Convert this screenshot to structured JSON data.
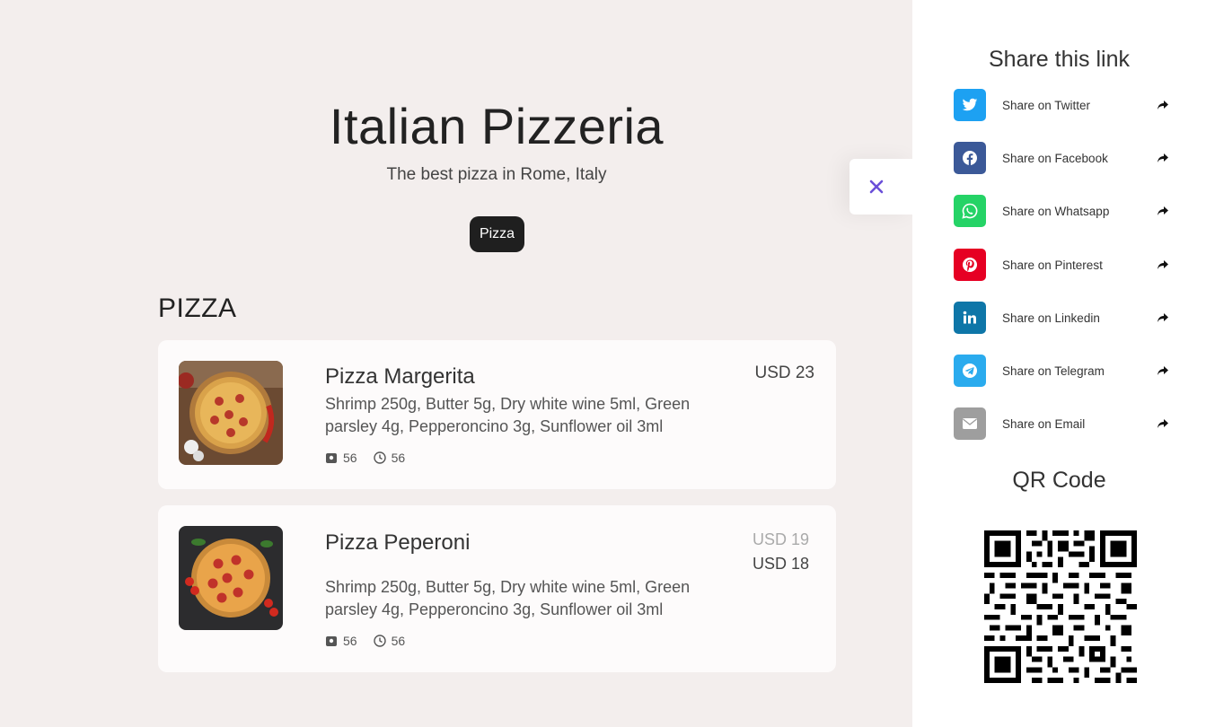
{
  "hero": {
    "title": "Italian Pizzeria",
    "subtitle": "The best pizza in Rome, Italy",
    "category_chip": "Pizza"
  },
  "section": {
    "title": "PIZZA"
  },
  "items": [
    {
      "name": "Pizza Margerita",
      "description": "Shrimp 250g, Butter 5g, Dry white wine 5ml, Green parsley 4g, Pepperoncino 3g, Sunflower oil 3ml",
      "weight": "56",
      "time": "56",
      "price": "USD 23"
    },
    {
      "name": "Pizza Peperoni",
      "description": "Shrimp 250g, Butter 5g, Dry white wine 5ml, Green parsley 4g, Pepperoncino 3g, Sunflower oil 3ml",
      "weight": "56",
      "time": "56",
      "price_old": "USD 19",
      "price_new": "USD 18"
    }
  ],
  "share_panel": {
    "title": "Share this link",
    "items": [
      {
        "label": "Share on Twitter",
        "icon": "twitter-icon",
        "color": "#1da1f2"
      },
      {
        "label": "Share on Facebook",
        "icon": "facebook-icon",
        "color": "#3b5998"
      },
      {
        "label": "Share on Whatsapp",
        "icon": "whatsapp-icon",
        "color": "#25d366"
      },
      {
        "label": "Share on Pinterest",
        "icon": "pinterest-icon",
        "color": "#e60023"
      },
      {
        "label": "Share on Linkedin",
        "icon": "linkedin-icon",
        "color": "#0e76a8"
      },
      {
        "label": "Share on Telegram",
        "icon": "telegram-icon",
        "color": "#2aabee"
      },
      {
        "label": "Share on Email",
        "icon": "email-icon",
        "color": "#9e9e9e"
      }
    ],
    "qr_title": "QR Code"
  },
  "colors": {
    "background": "#f3eeed",
    "card": "#fdfbfb",
    "chip": "#1f1f1f",
    "close_icon": "#6a4fd8"
  }
}
